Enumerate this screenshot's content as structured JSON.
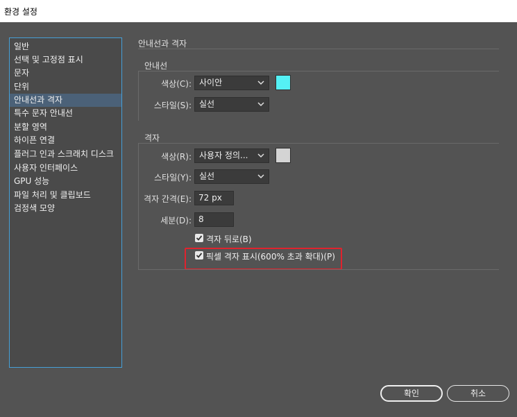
{
  "window": {
    "title": "환경 설정"
  },
  "sidebar": {
    "items": [
      {
        "label": "일반"
      },
      {
        "label": "선택 및 고정점 표시"
      },
      {
        "label": "문자"
      },
      {
        "label": "단위"
      },
      {
        "label": "안내선과 격자"
      },
      {
        "label": "특수 문자 안내선"
      },
      {
        "label": "분할 영역"
      },
      {
        "label": "하이픈 연결"
      },
      {
        "label": "플러그 인과 스크래치 디스크"
      },
      {
        "label": "사용자 인터페이스"
      },
      {
        "label": "GPU 성능"
      },
      {
        "label": "파일 처리 및 클립보드"
      },
      {
        "label": "검정색 모양"
      }
    ],
    "selected": "안내선과 격자"
  },
  "panel": {
    "title": "안내선과 격자",
    "guides": {
      "heading": "안내선",
      "color_label": "색상(C):",
      "color_value": "사이안",
      "color_swatch": "#55f1f5",
      "style_label": "스타일(S):",
      "style_value": "실선"
    },
    "grid": {
      "heading": "격자",
      "color_label": "색상(R):",
      "color_value": "사용자 정의...",
      "color_swatch": "#d4d4d4",
      "style_label": "스타일(Y):",
      "style_value": "실선",
      "gridline_label": "격자 간격(E):",
      "gridline_value": "72 px",
      "subdiv_label": "세분(D):",
      "subdiv_value": "8",
      "grids_back_label": "격자 뒤로(B)",
      "grids_back_checked": true,
      "pixel_grid_label": "픽셀 격자 표시(600% 초과 확대)(P)",
      "pixel_grid_checked": true
    }
  },
  "buttons": {
    "ok": "확인",
    "cancel": "취소"
  },
  "colors": {
    "highlight": "#e0232e",
    "selection": "#4b6178",
    "sidebar_border": "#46a0d8"
  }
}
